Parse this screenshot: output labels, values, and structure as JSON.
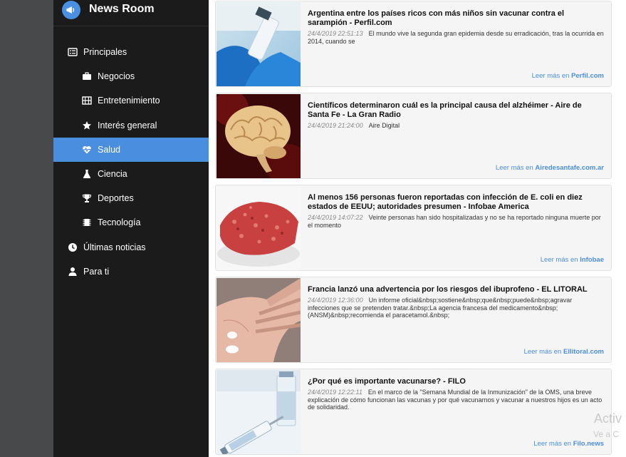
{
  "app": {
    "title": "News Room"
  },
  "colors": {
    "accent": "#4a8ee0",
    "sidebar_bg": "#1b1b1b",
    "card_bg": "#f5f5f5"
  },
  "sidebar": {
    "items": [
      {
        "label": "Principales",
        "icon": "list-icon",
        "level": "top",
        "active": false
      },
      {
        "label": "Negocios",
        "icon": "briefcase-icon",
        "level": "sub",
        "active": false
      },
      {
        "label": "Entretenimiento",
        "icon": "film-icon",
        "level": "sub",
        "active": false
      },
      {
        "label": "Interés general",
        "icon": "star-icon",
        "level": "sub",
        "active": false
      },
      {
        "label": "Salud",
        "icon": "heartbeat-icon",
        "level": "sub",
        "active": true
      },
      {
        "label": "Ciencia",
        "icon": "flask-icon",
        "level": "sub",
        "active": false
      },
      {
        "label": "Deportes",
        "icon": "trophy-icon",
        "level": "sub",
        "active": false
      },
      {
        "label": "Tecnología",
        "icon": "chip-icon",
        "level": "sub",
        "active": false
      },
      {
        "label": "Últimas noticias",
        "icon": "clock-icon",
        "level": "top",
        "active": false
      },
      {
        "label": "Para ti",
        "icon": "user-icon",
        "level": "top",
        "active": false
      }
    ]
  },
  "articles": [
    {
      "title": "Argentina entre los países ricos con más niños sin vacunar contra el sarampión - Perfil.com",
      "date": "24/4/2019 22:51:13",
      "description": "El mundo vive la segunda gran epidemia desde su erradicación, tras la ocurrida en 2014, cuando se",
      "more_prefix": "Leer más en ",
      "source": "Perfil.com",
      "image": "vaccine-vial-image"
    },
    {
      "title": "Científicos determinaron cuál es la principal causa del alzhéimer - Aire de Santa Fe - La Gran Radio",
      "date": "24/4/2019 21:24:00",
      "description": "Aire Digital",
      "more_prefix": "Leer más en ",
      "source": "Airedesantafe.com.ar",
      "image": "brain-image"
    },
    {
      "title": "Al menos 156 personas fueron reportadas con infección de E. coli en diez estados de EEUU; autoridades presumen - Infobae America",
      "date": "24/4/2019 14:07:22",
      "description": "Veinte personas han sido hospitalizadas y no se ha reportado ninguna muerte por el momento",
      "more_prefix": "Leer más en ",
      "source": "Infobae",
      "image": "ground-beef-image"
    },
    {
      "title": "Francia lanzó una advertencia por los riesgos del ibuprofeno - EL LITORAL",
      "date": "24/4/2019 12:36:00",
      "description": "Un informe oficial&nbsp;sostiene&nbsp;que&nbsp;puede&nbsp;agravar infecciones que se pretenden tratar.&nbsp;La agencia francesa del medicamento&nbsp;(ANSM)&nbsp;recomienda el paracetamol.&nbsp;",
      "more_prefix": "Leer más en ",
      "source": "Ellitoral.com",
      "image": "pills-in-hand-image"
    },
    {
      "title": "¿Por qué es importante vacunarse? - FILO",
      "date": "24/4/2019 12:22:11",
      "description": "En el marco de la \"Semana Mundial de la Inmunización\" de la OMS, una breve explicación de cómo funcionan las vacunas y por qué vacunarnos y vacunar a nuestros hijos es un acto de solidaridad.",
      "more_prefix": "Leer más en ",
      "source": "Filo.news",
      "image": "syringe-vial-image"
    }
  ],
  "watermark": {
    "line1": "Activ",
    "line2": "Ve a C"
  }
}
